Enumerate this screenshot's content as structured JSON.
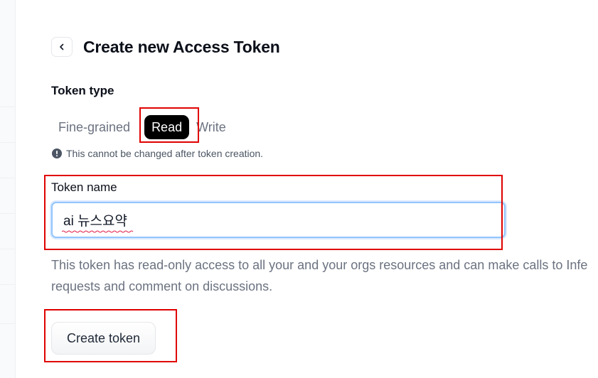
{
  "page": {
    "title": "Create new Access Token"
  },
  "token_type": {
    "label": "Token type",
    "options": [
      {
        "label": "Fine-grained",
        "active": false
      },
      {
        "label": "Read",
        "active": true
      },
      {
        "label": "Write",
        "active": false
      }
    ],
    "note": "This cannot be changed after token creation."
  },
  "token_name": {
    "label": "Token name",
    "value": "ai 뉴스요약"
  },
  "description": {
    "line1": "This token has read-only access to all your and your orgs resources and can make calls to Infe",
    "line2": "requests and comment on discussions."
  },
  "actions": {
    "create_label": "Create token"
  },
  "icons": {
    "back": "chevron-left-icon",
    "note": "exclamation-circle-icon"
  },
  "colors": {
    "active_bg": "#000000",
    "annotation": "#e00000",
    "input_focus": "#93c5fd",
    "muted_text": "#6b7280"
  }
}
